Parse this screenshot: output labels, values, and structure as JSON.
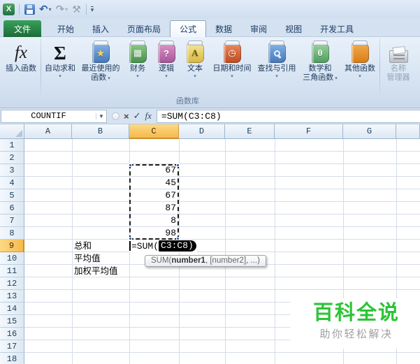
{
  "qat": {
    "logo": "X",
    "undo_glyph": "↶",
    "redo_glyph": "↷",
    "tools_glyph": "⚒",
    "more_glyph": "▾",
    "dropdown_glyph": "▾"
  },
  "tabs": {
    "file_label": "文件",
    "items": [
      {
        "name": "tab-home",
        "label": "开始"
      },
      {
        "name": "tab-insert",
        "label": "插入"
      },
      {
        "name": "tab-page-layout",
        "label": "页面布局"
      },
      {
        "name": "tab-formulas",
        "label": "公式",
        "active": true
      },
      {
        "name": "tab-data",
        "label": "数据"
      },
      {
        "name": "tab-review",
        "label": "审阅"
      },
      {
        "name": "tab-view",
        "label": "视图"
      },
      {
        "name": "tab-developer",
        "label": "开发工具"
      }
    ]
  },
  "ribbon": {
    "group_label": "函数库",
    "buttons": [
      {
        "name": "insert-function-button",
        "icon_name": "fx-function-icon",
        "icon": "fx",
        "label": "插入函数",
        "label_lines": [
          "插入函数"
        ],
        "dropdown": false
      },
      {
        "name": "autosum-button",
        "icon_name": "sigma-autosum-icon",
        "icon": "sigma",
        "glyph": "Σ",
        "label": "自动求和",
        "label_lines": [
          "自动求和"
        ],
        "dropdown": true
      },
      {
        "name": "recently-used-button",
        "icon_name": "recent-functions-book-icon",
        "icon": "book",
        "color": "bk-blue",
        "glyph": "★",
        "glyph_class": "gold",
        "label": "最近使用的函数",
        "label_lines": [
          "最近使用的",
          "函数"
        ],
        "dropdown": true
      },
      {
        "name": "financial-button",
        "icon_name": "financial-book-icon",
        "icon": "book",
        "color": "bk-green",
        "glyph": "▦",
        "label": "财务",
        "label_lines": [
          "财务"
        ],
        "dropdown": true
      },
      {
        "name": "logical-button",
        "icon_name": "logical-book-icon",
        "icon": "book",
        "color": "bk-pink",
        "glyph": "?",
        "label": "逻辑",
        "label_lines": [
          "逻辑"
        ],
        "dropdown": true
      },
      {
        "name": "text-button",
        "icon_name": "text-book-icon",
        "icon": "book",
        "color": "bk-yellow",
        "glyph": "A",
        "glyph_class": "dark",
        "label": "文本",
        "label_lines": [
          "文本"
        ],
        "dropdown": true
      },
      {
        "name": "date-time-button",
        "icon_name": "date-time-book-icon",
        "icon": "book",
        "color": "bk-red",
        "glyph": "◷",
        "label": "日期和时间",
        "label_lines": [
          "日期和时间"
        ],
        "dropdown": true
      },
      {
        "name": "lookup-reference-button",
        "icon_name": "lookup-reference-book-icon",
        "icon": "book-mag",
        "color": "bk-blue",
        "label": "查找与引用",
        "label_lines": [
          "查找与引用"
        ],
        "dropdown": true
      },
      {
        "name": "math-trig-button",
        "icon_name": "math-trig-book-icon",
        "icon": "book",
        "color": "bk-teal",
        "glyph": "θ",
        "glyph_class": "theta",
        "label": "数学和三角函数",
        "label_lines": [
          "数学和",
          "三角函数"
        ],
        "dropdown": true
      },
      {
        "name": "more-functions-button",
        "icon_name": "more-functions-books-icon",
        "icon": "book-double",
        "color": "bk-orange",
        "glyph": "",
        "label": "其他函数",
        "label_lines": [
          "其他函数"
        ],
        "dropdown": true
      }
    ],
    "name_manager": {
      "name": "name-manager-button",
      "icon_name": "name-manager-drawer-icon",
      "label": "名称管理器",
      "label_lines": [
        "名称",
        "管理器"
      ],
      "disabled": true
    }
  },
  "formula_bar": {
    "name_box_value": "COUNTIF",
    "cancel_glyph": "×",
    "enter_glyph": "✓",
    "fx_glyph": "fx",
    "formula": "=SUM(C3:C8)"
  },
  "sheet": {
    "column_headers": [
      "A",
      "B",
      "C",
      "D",
      "E",
      "F",
      "G"
    ],
    "highlighted_column": "C",
    "row_count": 18,
    "highlighted_row": 9,
    "cells": [
      {
        "ref": "C3",
        "col": "C",
        "row": 3,
        "value": "67",
        "align": "right"
      },
      {
        "ref": "C4",
        "col": "C",
        "row": 4,
        "value": "45",
        "align": "right"
      },
      {
        "ref": "C5",
        "col": "C",
        "row": 5,
        "value": "67",
        "align": "right"
      },
      {
        "ref": "C6",
        "col": "C",
        "row": 6,
        "value": "87",
        "align": "right"
      },
      {
        "ref": "C7",
        "col": "C",
        "row": 7,
        "value": "8",
        "align": "right"
      },
      {
        "ref": "C8",
        "col": "C",
        "row": 8,
        "value": "98",
        "align": "right"
      },
      {
        "ref": "B9",
        "col": "B",
        "row": 9,
        "value": "总和",
        "align": "left"
      },
      {
        "ref": "B10",
        "col": "B",
        "row": 10,
        "value": "平均值",
        "align": "left"
      },
      {
        "ref": "B11",
        "col": "B",
        "row": 11,
        "value": "加权平均值",
        "align": "left"
      }
    ],
    "selection_range": "C3:C8",
    "edit_cell": {
      "ref": "C9",
      "text_before": "=SUM(",
      "highlighted_text": "C3:C8)"
    }
  },
  "tooltip": {
    "prefix": "SUM(",
    "bold": "number1",
    "suffix": ", [number2], ...)"
  },
  "watermark": {
    "title": "百科全说",
    "subtitle": "助你轻松解决",
    "title_color": "#2cc436",
    "subtitle_color": "#a0a0a0"
  }
}
